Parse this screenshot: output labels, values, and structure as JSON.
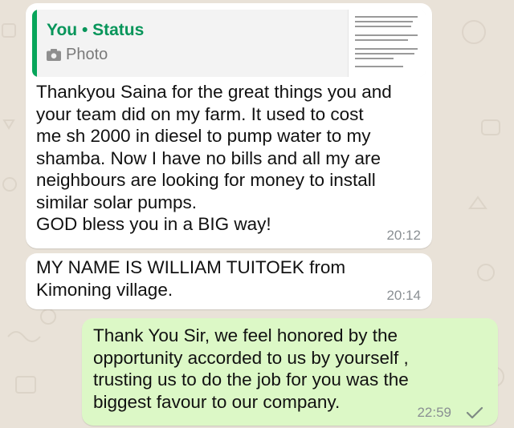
{
  "quote": {
    "author": "You • Status",
    "type_label": "Photo",
    "type_icon": "camera-icon"
  },
  "messages": [
    {
      "direction": "incoming",
      "text": "Thankyou Saina for the great things you and\nyour team did on my farm. It used to  cost\nme sh 2000 in diesel to pump water to my\nshamba. Now I have no bills and all my are\nneighbours are looking for money to install\nsimilar solar pumps.\nGOD bless you in a BIG way!",
      "time": "20:12"
    },
    {
      "direction": "incoming",
      "text": "MY NAME IS WILLIAM TUITOEK  from\nKimoning village.",
      "time": "20:14"
    },
    {
      "direction": "outgoing",
      "text": "Thank You Sir, we feel honored by the\nopportunity accorded to us by yourself ,\ntrusting us to do the job for you was the\nbiggest favour to our company.",
      "time": "22:59",
      "status_icon": "single-check-icon"
    }
  ],
  "colors": {
    "chat_background": "#e9e2d8",
    "incoming_bubble": "#ffffff",
    "outgoing_bubble": "#dcf8c6",
    "quote_accent": "#07a55a",
    "timestamp": "#8a8f93"
  }
}
